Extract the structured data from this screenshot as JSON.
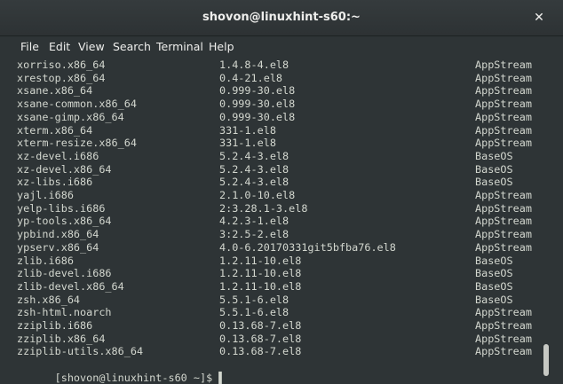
{
  "window": {
    "title": "shovon@linuxhint-s60:~",
    "close_glyph": "✕"
  },
  "menu": [
    "File",
    "Edit",
    "View",
    "Search",
    "Terminal",
    "Help"
  ],
  "packages": [
    {
      "name": "xorriso.x86_64",
      "version": "1.4.8-4.el8",
      "repo": "AppStream"
    },
    {
      "name": "xrestop.x86_64",
      "version": "0.4-21.el8",
      "repo": "AppStream"
    },
    {
      "name": "xsane.x86_64",
      "version": "0.999-30.el8",
      "repo": "AppStream"
    },
    {
      "name": "xsane-common.x86_64",
      "version": "0.999-30.el8",
      "repo": "AppStream"
    },
    {
      "name": "xsane-gimp.x86_64",
      "version": "0.999-30.el8",
      "repo": "AppStream"
    },
    {
      "name": "xterm.x86_64",
      "version": "331-1.el8",
      "repo": "AppStream"
    },
    {
      "name": "xterm-resize.x86_64",
      "version": "331-1.el8",
      "repo": "AppStream"
    },
    {
      "name": "xz-devel.i686",
      "version": "5.2.4-3.el8",
      "repo": "BaseOS"
    },
    {
      "name": "xz-devel.x86_64",
      "version": "5.2.4-3.el8",
      "repo": "BaseOS"
    },
    {
      "name": "xz-libs.i686",
      "version": "5.2.4-3.el8",
      "repo": "BaseOS"
    },
    {
      "name": "yajl.i686",
      "version": "2.1.0-10.el8",
      "repo": "AppStream"
    },
    {
      "name": "yelp-libs.i686",
      "version": "2:3.28.1-3.el8",
      "repo": "AppStream"
    },
    {
      "name": "yp-tools.x86_64",
      "version": "4.2.3-1.el8",
      "repo": "AppStream"
    },
    {
      "name": "ypbind.x86_64",
      "version": "3:2.5-2.el8",
      "repo": "AppStream"
    },
    {
      "name": "ypserv.x86_64",
      "version": "4.0-6.20170331git5bfba76.el8",
      "repo": "AppStream"
    },
    {
      "name": "zlib.i686",
      "version": "1.2.11-10.el8",
      "repo": "BaseOS"
    },
    {
      "name": "zlib-devel.i686",
      "version": "1.2.11-10.el8",
      "repo": "BaseOS"
    },
    {
      "name": "zlib-devel.x86_64",
      "version": "1.2.11-10.el8",
      "repo": "BaseOS"
    },
    {
      "name": "zsh.x86_64",
      "version": "5.5.1-6.el8",
      "repo": "BaseOS"
    },
    {
      "name": "zsh-html.noarch",
      "version": "5.5.1-6.el8",
      "repo": "AppStream"
    },
    {
      "name": "zziplib.i686",
      "version": "0.13.68-7.el8",
      "repo": "AppStream"
    },
    {
      "name": "zziplib.x86_64",
      "version": "0.13.68-7.el8",
      "repo": "AppStream"
    },
    {
      "name": "zziplib-utils.x86_64",
      "version": "0.13.68-7.el8",
      "repo": "AppStream"
    }
  ],
  "prompt": "[shovon@linuxhint-s60 ~]$ ",
  "cursor_glyph": "▌",
  "colors": {
    "background": "#2e3436",
    "foreground": "#d3d7cf",
    "titlebar": "#353b3d"
  }
}
